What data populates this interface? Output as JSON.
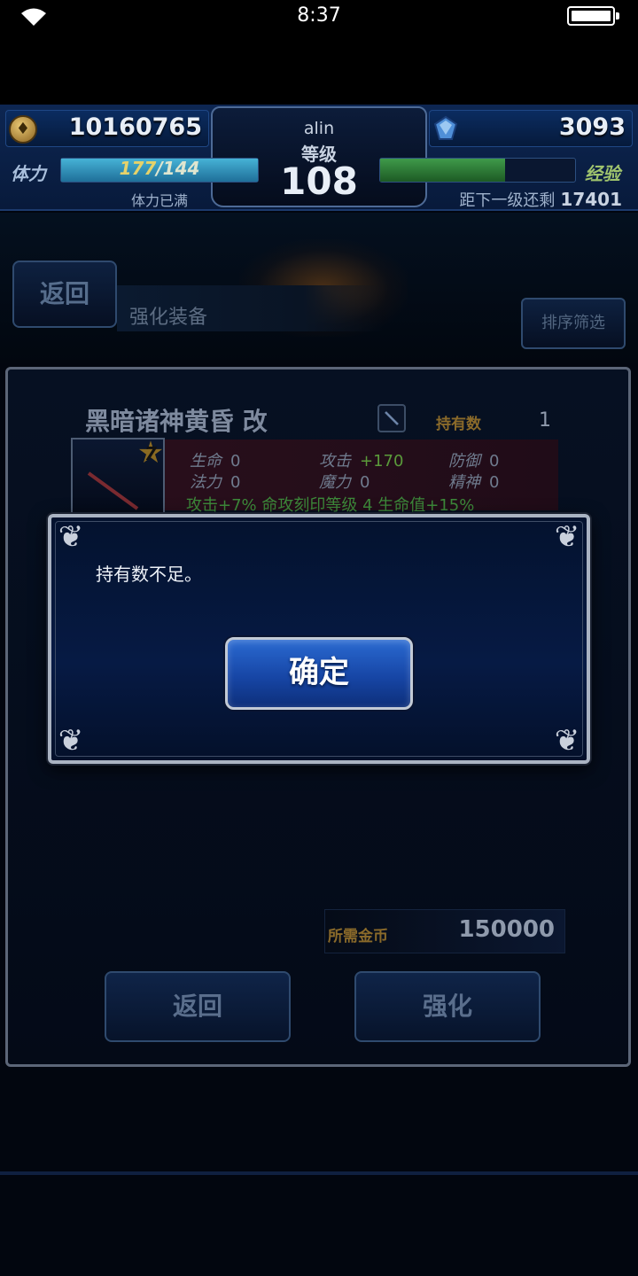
{
  "status_bar": {
    "time": "8:37"
  },
  "header": {
    "gold": "10160765",
    "gems": "3093",
    "player_name": "alin",
    "level_label": "等级",
    "level": "108",
    "stamina_label": "体力",
    "stamina_current": "177",
    "stamina_max": "/144",
    "stamina_fraction": 1.0,
    "stamina_note": "体力已满",
    "exp_label": "经验",
    "exp_fraction": 0.64,
    "exp_note_label": "距下一级还剩",
    "exp_remaining": "17401"
  },
  "screen": {
    "back_label": "返回",
    "title": "强化装备",
    "sort_label": "排序筛选"
  },
  "equipment": {
    "name": "黑暗诸神黄昏 改",
    "owned_label": "持有数",
    "owned_count": "1",
    "rarity": "7",
    "stats": [
      {
        "label": "生命",
        "value": "0"
      },
      {
        "label": "攻击",
        "value": "+170"
      },
      {
        "label": "防御",
        "value": "0"
      },
      {
        "label": "法力",
        "value": "0"
      },
      {
        "label": "魔力",
        "value": "0"
      },
      {
        "label": "精神",
        "value": "0"
      }
    ],
    "effect": "攻击+7% 命攻刻印等级 4 生命值+15%"
  },
  "cost": {
    "label": "所需金币",
    "value": "150000"
  },
  "actions": {
    "back_label": "返回",
    "enhance_label": "强化"
  },
  "dialog": {
    "message": "持有数不足。",
    "ok_label": "确定"
  }
}
